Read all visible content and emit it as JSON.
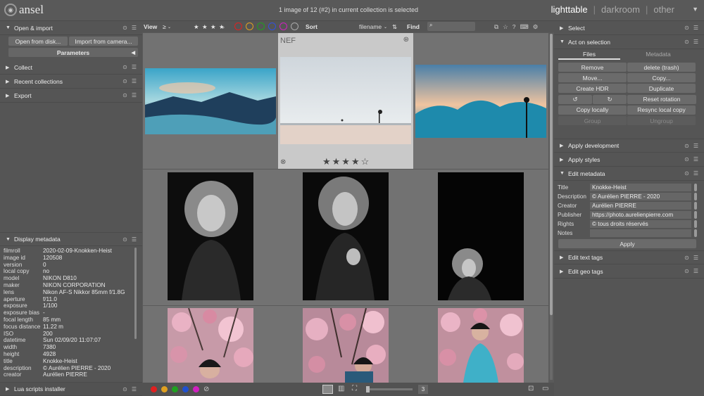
{
  "app": {
    "logo_text": "ansel"
  },
  "status_text": "1 image of 12 (#2) in current collection is selected",
  "views": [
    "lighttable",
    "|",
    "darkroom",
    "|",
    "other"
  ],
  "left_panel": {
    "open_import": {
      "title": "Open & import",
      "btn_disk": "Open from disk...",
      "btn_camera": "Import from camera...",
      "parameters": "Parameters"
    },
    "collect": "Collect",
    "recent": "Recent collections",
    "export": "Export",
    "display_metadata": "Display metadata",
    "metadata": [
      {
        "k": "filmroll",
        "v": "2020-02-09-Knokken-Heist"
      },
      {
        "k": "image id",
        "v": "120508"
      },
      {
        "k": "version",
        "v": "0"
      },
      {
        "k": "local copy",
        "v": "no"
      },
      {
        "k": "model",
        "v": "NIKON D810"
      },
      {
        "k": "maker",
        "v": "NIKON CORPORATION"
      },
      {
        "k": "lens",
        "v": "Nikon AF-S Nikkor 85mm f/1.8G"
      },
      {
        "k": "aperture",
        "v": "f/11.0"
      },
      {
        "k": "exposure",
        "v": "1/100"
      },
      {
        "k": "exposure bias",
        "v": "-"
      },
      {
        "k": "focal length",
        "v": "85 mm"
      },
      {
        "k": "focus distance",
        "v": "11.22 m"
      },
      {
        "k": "ISO",
        "v": "200"
      },
      {
        "k": "datetime",
        "v": "Sun 02/09/20 11:07:07"
      },
      {
        "k": "width",
        "v": "7380"
      },
      {
        "k": "height",
        "v": "4928"
      },
      {
        "k": "title",
        "v": "Knokke-Heist"
      },
      {
        "k": "description",
        "v": "© Aurélien PIERRE - 2020"
      },
      {
        "k": "creator",
        "v": "Aurélien PIERRE"
      }
    ],
    "lua": "Lua scripts installer"
  },
  "toolbar": {
    "view": "View",
    "ge": "≥",
    "stars": "★ ★ ★ ★",
    "sort": "Sort",
    "sort_value": "filename",
    "find": "Find"
  },
  "thumbs": {
    "selected_label": "NEF",
    "selected_stars": "★★★★☆"
  },
  "bottombar": {
    "zoom_value": "3",
    "colors": [
      "#e02020",
      "#e0a020",
      "#20a020",
      "#2050d0",
      "#d020c0"
    ]
  },
  "right_panel": {
    "select": "Select",
    "act_on_selection": "Act on selection",
    "tabs": [
      "Files",
      "Metadata"
    ],
    "buttons": [
      [
        "Remove",
        "delete (trash)"
      ],
      [
        "Move...",
        "Copy..."
      ],
      [
        "Create HDR",
        "Duplicate"
      ],
      [
        "↺",
        "↻",
        "Reset rotation"
      ],
      [
        "Copy locally",
        "Resync local copy"
      ],
      [
        "Group",
        "Ungroup"
      ]
    ],
    "apply_development": "Apply development",
    "apply_styles": "Apply styles",
    "edit_metadata": "Edit metadata",
    "metadata_fields": [
      {
        "k": "Title",
        "v": "Knokke-Heist"
      },
      {
        "k": "Description",
        "v": "© Aurélien PIERRE - 2020"
      },
      {
        "k": "Creator",
        "v": "Aurélien PIERRE"
      },
      {
        "k": "Publisher",
        "v": "https://photo.aurelienpierre.com"
      },
      {
        "k": "Rights",
        "v": "© tous droits réservés"
      },
      {
        "k": "Notes",
        "v": ""
      }
    ],
    "apply": "Apply",
    "edit_text_tags": "Edit text tags",
    "edit_geo_tags": "Edit geo tags"
  }
}
